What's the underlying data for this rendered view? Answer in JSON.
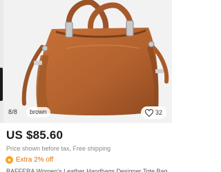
{
  "gallery": {
    "counter": "8/8",
    "variant": "brown",
    "likes": "32"
  },
  "product": {
    "price": "US $85.60",
    "price_note": "Price shown before tax, Free shipping",
    "promo": "Extra 2% off",
    "promo_icon": "coupon-icon",
    "title_peek": "BAFFERA Women's Leather Handbags Designer Tote Bag"
  },
  "colors": {
    "leather": "#b4622e",
    "promo": "#e07000",
    "promo_icon": "#f5a623"
  }
}
